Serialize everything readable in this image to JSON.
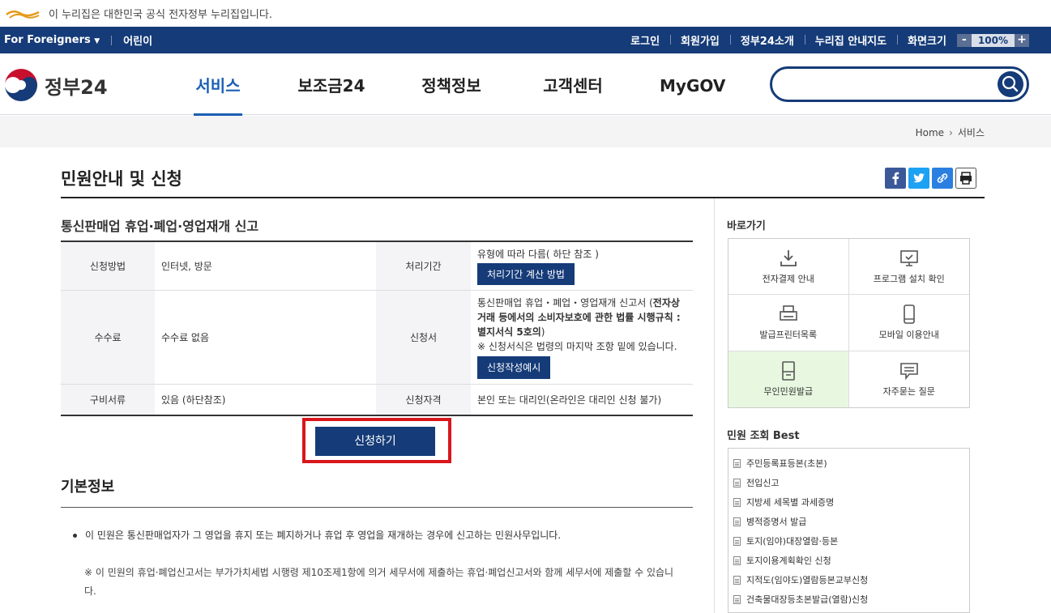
{
  "gov_banner": {
    "text": "이 누리집은 대한민국 공식 전자정부 누리집입니다."
  },
  "utility": {
    "foreigners": "For Foreigners",
    "kids": "어린이",
    "links": [
      "로그인",
      "회원가입",
      "정부24소개",
      "누리집 안내지도",
      "화면크기"
    ],
    "zoom_minus": "-",
    "zoom_value": "100%",
    "zoom_plus": "+"
  },
  "header": {
    "logo_text": "정부24",
    "nav": [
      {
        "label": "서비스"
      },
      {
        "label": "보조금24"
      },
      {
        "label": "정책정보"
      },
      {
        "label": "고객센터"
      },
      {
        "label": "MyGOV"
      }
    ],
    "search_placeholder": ""
  },
  "breadcrumb": {
    "home": "Home",
    "current": "서비스"
  },
  "page": {
    "title": "민원안내 및 신청"
  },
  "service": {
    "title": "통신판매업 휴업·폐업·영업재개 신고",
    "rows": [
      {
        "label1": "신청방법",
        "value1": "인터넷, 방문",
        "label2": "처리기간",
        "value2": "유형에 따라 다름( 하단 참조 )",
        "button2": "처리기간 계산 방법"
      },
      {
        "label1": "수수료",
        "value1": "수수료 없음",
        "label2": "신청서",
        "value2a": "통신판매업 휴업・폐업・영업재개 신고서 (",
        "value2b": "전자상거래 등에서의 소비자보호에 관한 법률 시행규칙 : 별지서식 5호의",
        "value2c": ")",
        "note": "※ 신청서식은 법령의 마지막 조항 밑에 있습니다.",
        "button2": "신청작성예시"
      },
      {
        "label1": "구비서류",
        "value1": "있음 (하단참조)",
        "label2": "신청자격",
        "value2": "본인 또는 대리인(온라인은 대리인 신청 불가)"
      }
    ],
    "apply_button": "신청하기"
  },
  "basic": {
    "title": "기본정보",
    "text": "이 민원은 통신판매업자가 그 영업을 휴지 또는 폐지하거나 휴업 후 영업을 재개하는 경우에 신고하는 민원사무입니다.",
    "note": "※ 이 민원의 휴업·폐업신고서는 부가가치세법 시행령 제10조제1항에 의거 세무서에 제출하는 휴업·폐업신고서와 함께 세무서에 제출할 수 있습니다."
  },
  "quick": {
    "title": "바로가기",
    "items": [
      {
        "label": "전자결제 안내",
        "icon": "download-icon"
      },
      {
        "label": "프로그램 설치 확인",
        "icon": "monitor-icon"
      },
      {
        "label": "발급프린터목록",
        "icon": "printer-icon"
      },
      {
        "label": "모바일 이용안내",
        "icon": "mobile-icon"
      },
      {
        "label": "무인민원발급",
        "icon": "kiosk-icon"
      },
      {
        "label": "자주묻는 질문",
        "icon": "chat-icon"
      }
    ]
  },
  "best": {
    "title": "민원 조회 Best",
    "items": [
      "주민등록표등본(초본)",
      "전입신고",
      "지방세 세목별 과세증명",
      "병적증명서 발급",
      "토지(임야)대장열람·등본",
      "토지이용계획확인 신청",
      "지적도(임야도)열람등본교부신청",
      "건축물대장등초본발급(열람)신청"
    ]
  },
  "colors": {
    "primary": "#153b78",
    "accent": "#1a5fb4",
    "highlight_border": "#d9161c"
  }
}
